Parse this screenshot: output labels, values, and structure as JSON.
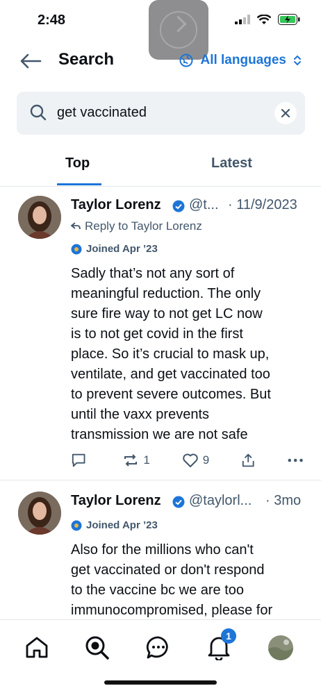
{
  "status": {
    "time": "2:48"
  },
  "header": {
    "title": "Search",
    "language_label": "All languages"
  },
  "search": {
    "query": "get vaccinated"
  },
  "tabs": [
    {
      "label": "Top"
    },
    {
      "label": "Latest"
    }
  ],
  "posts": [
    {
      "author": "Taylor Lorenz",
      "handle": "@t...",
      "time": "· 11/9/2023",
      "reply_to": "Reply to Taylor Lorenz",
      "joined": "Joined Apr ’23",
      "text": "Sadly that’s not any sort of\nmeaningful reduction. The only\nsure fire way to not get LC now\nis to not get covid in the first\nplace. So it’s crucial to mask up,\nventilate, and get vaccinated too\nto prevent severe outcomes. But\nuntil the vaxx prevents\ntransmission we are not safe",
      "reposts": "1",
      "likes": "9"
    },
    {
      "author": "Taylor Lorenz",
      "handle": "@taylorl...",
      "time": "· 3mo",
      "joined": "Joined Apr ’23",
      "text": "Also for the millions who can't\nget vaccinated or don't respond\nto the vaccine bc we are too\nimmunocompromised, please for"
    }
  ],
  "bottom_nav": {
    "notifications_badge": "1"
  },
  "colors": {
    "accent": "#1d75d7",
    "muted": "#42576b"
  }
}
